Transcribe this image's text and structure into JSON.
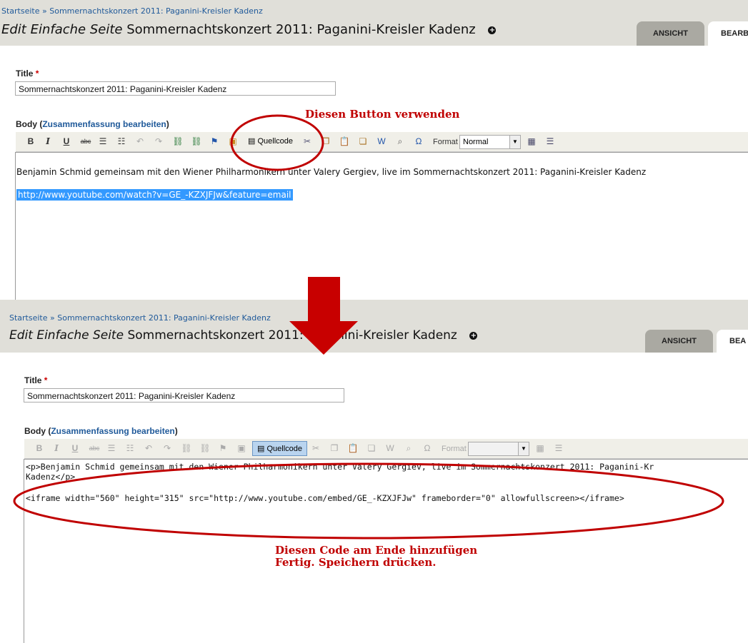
{
  "top": {
    "breadcrumb": {
      "home": "Startseite",
      "sep": "»",
      "current": "Sommernachtskonzert 2011: Paganini-Kreisler Kadenz"
    },
    "title_prefix": "Edit Einfache Seite",
    "title_node": "Sommernachtskonzert 2011: Paganini-Kreisler Kadenz",
    "tabs": [
      {
        "label": "ANSICHT"
      },
      {
        "label": "BEARB"
      }
    ],
    "title_label": "Title",
    "required_mark": "*",
    "title_value": "Sommernachtskonzert 2011: Paganini-Kreisler Kadenz",
    "body_label": "Body",
    "summary_link": "Zusammenfassung bearbeiten",
    "toolbar": {
      "bold": "B",
      "italic": "I",
      "underline": "U",
      "strike": "abc",
      "source_label": "Quellcode",
      "format_label": "Format",
      "format_value": "Normal"
    },
    "editor_text": "Benjamin Schmid gemeinsam mit den Wiener Philharmonikern unter Valery Gergiev, live im Sommernachtskonzert 2011: Paganini-Kreisler Kadenz",
    "editor_link": "http://www.youtube.com/watch?v=GE_-KZXJFJw&feature=email",
    "annotation": "Diesen Button verwenden"
  },
  "bottom": {
    "breadcrumb": {
      "home": "Startseite",
      "sep": "»",
      "current": "Sommernachtskonzert 2011: Paganini-Kreisler Kadenz"
    },
    "title_prefix": "Edit Einfache Seite",
    "title_node": "Sommernachtskonzert 2011: Paganini-Kreisler Kadenz",
    "tabs": [
      {
        "label": "ANSICHT"
      },
      {
        "label": "BEA"
      }
    ],
    "title_label": "Title",
    "required_mark": "*",
    "title_value": "Sommernachtskonzert 2011: Paganini-Kreisler Kadenz",
    "body_label": "Body",
    "summary_link": "Zusammenfassung bearbeiten",
    "toolbar": {
      "bold": "B",
      "italic": "I",
      "underline": "U",
      "strike": "abc",
      "source_label": "Quellcode",
      "format_label": "Format",
      "format_value": ""
    },
    "code_line1": "<p>Benjamin Schmid gemeinsam mit den Wiener Philharmonikern unter Valery Gergiev, live im Sommernachtskonzert 2011: Paganini-Kr",
    "code_line2": "Kadenz</p>",
    "code_line3": "<iframe width=\"560\" height=\"315\" src=\"http://www.youtube.com/embed/GE_-KZXJFJw\" frameborder=\"0\" allowfullscreen></iframe>",
    "annotation_line1": "Diesen Code am Ende hinzufügen",
    "annotation_line2": "Fertig. Speichern drücken."
  },
  "colors": {
    "header_bg": "#e0dfd9",
    "annotation_red": "#c00000",
    "link_blue": "#205a9a",
    "active_button": "#b9d4ef"
  }
}
